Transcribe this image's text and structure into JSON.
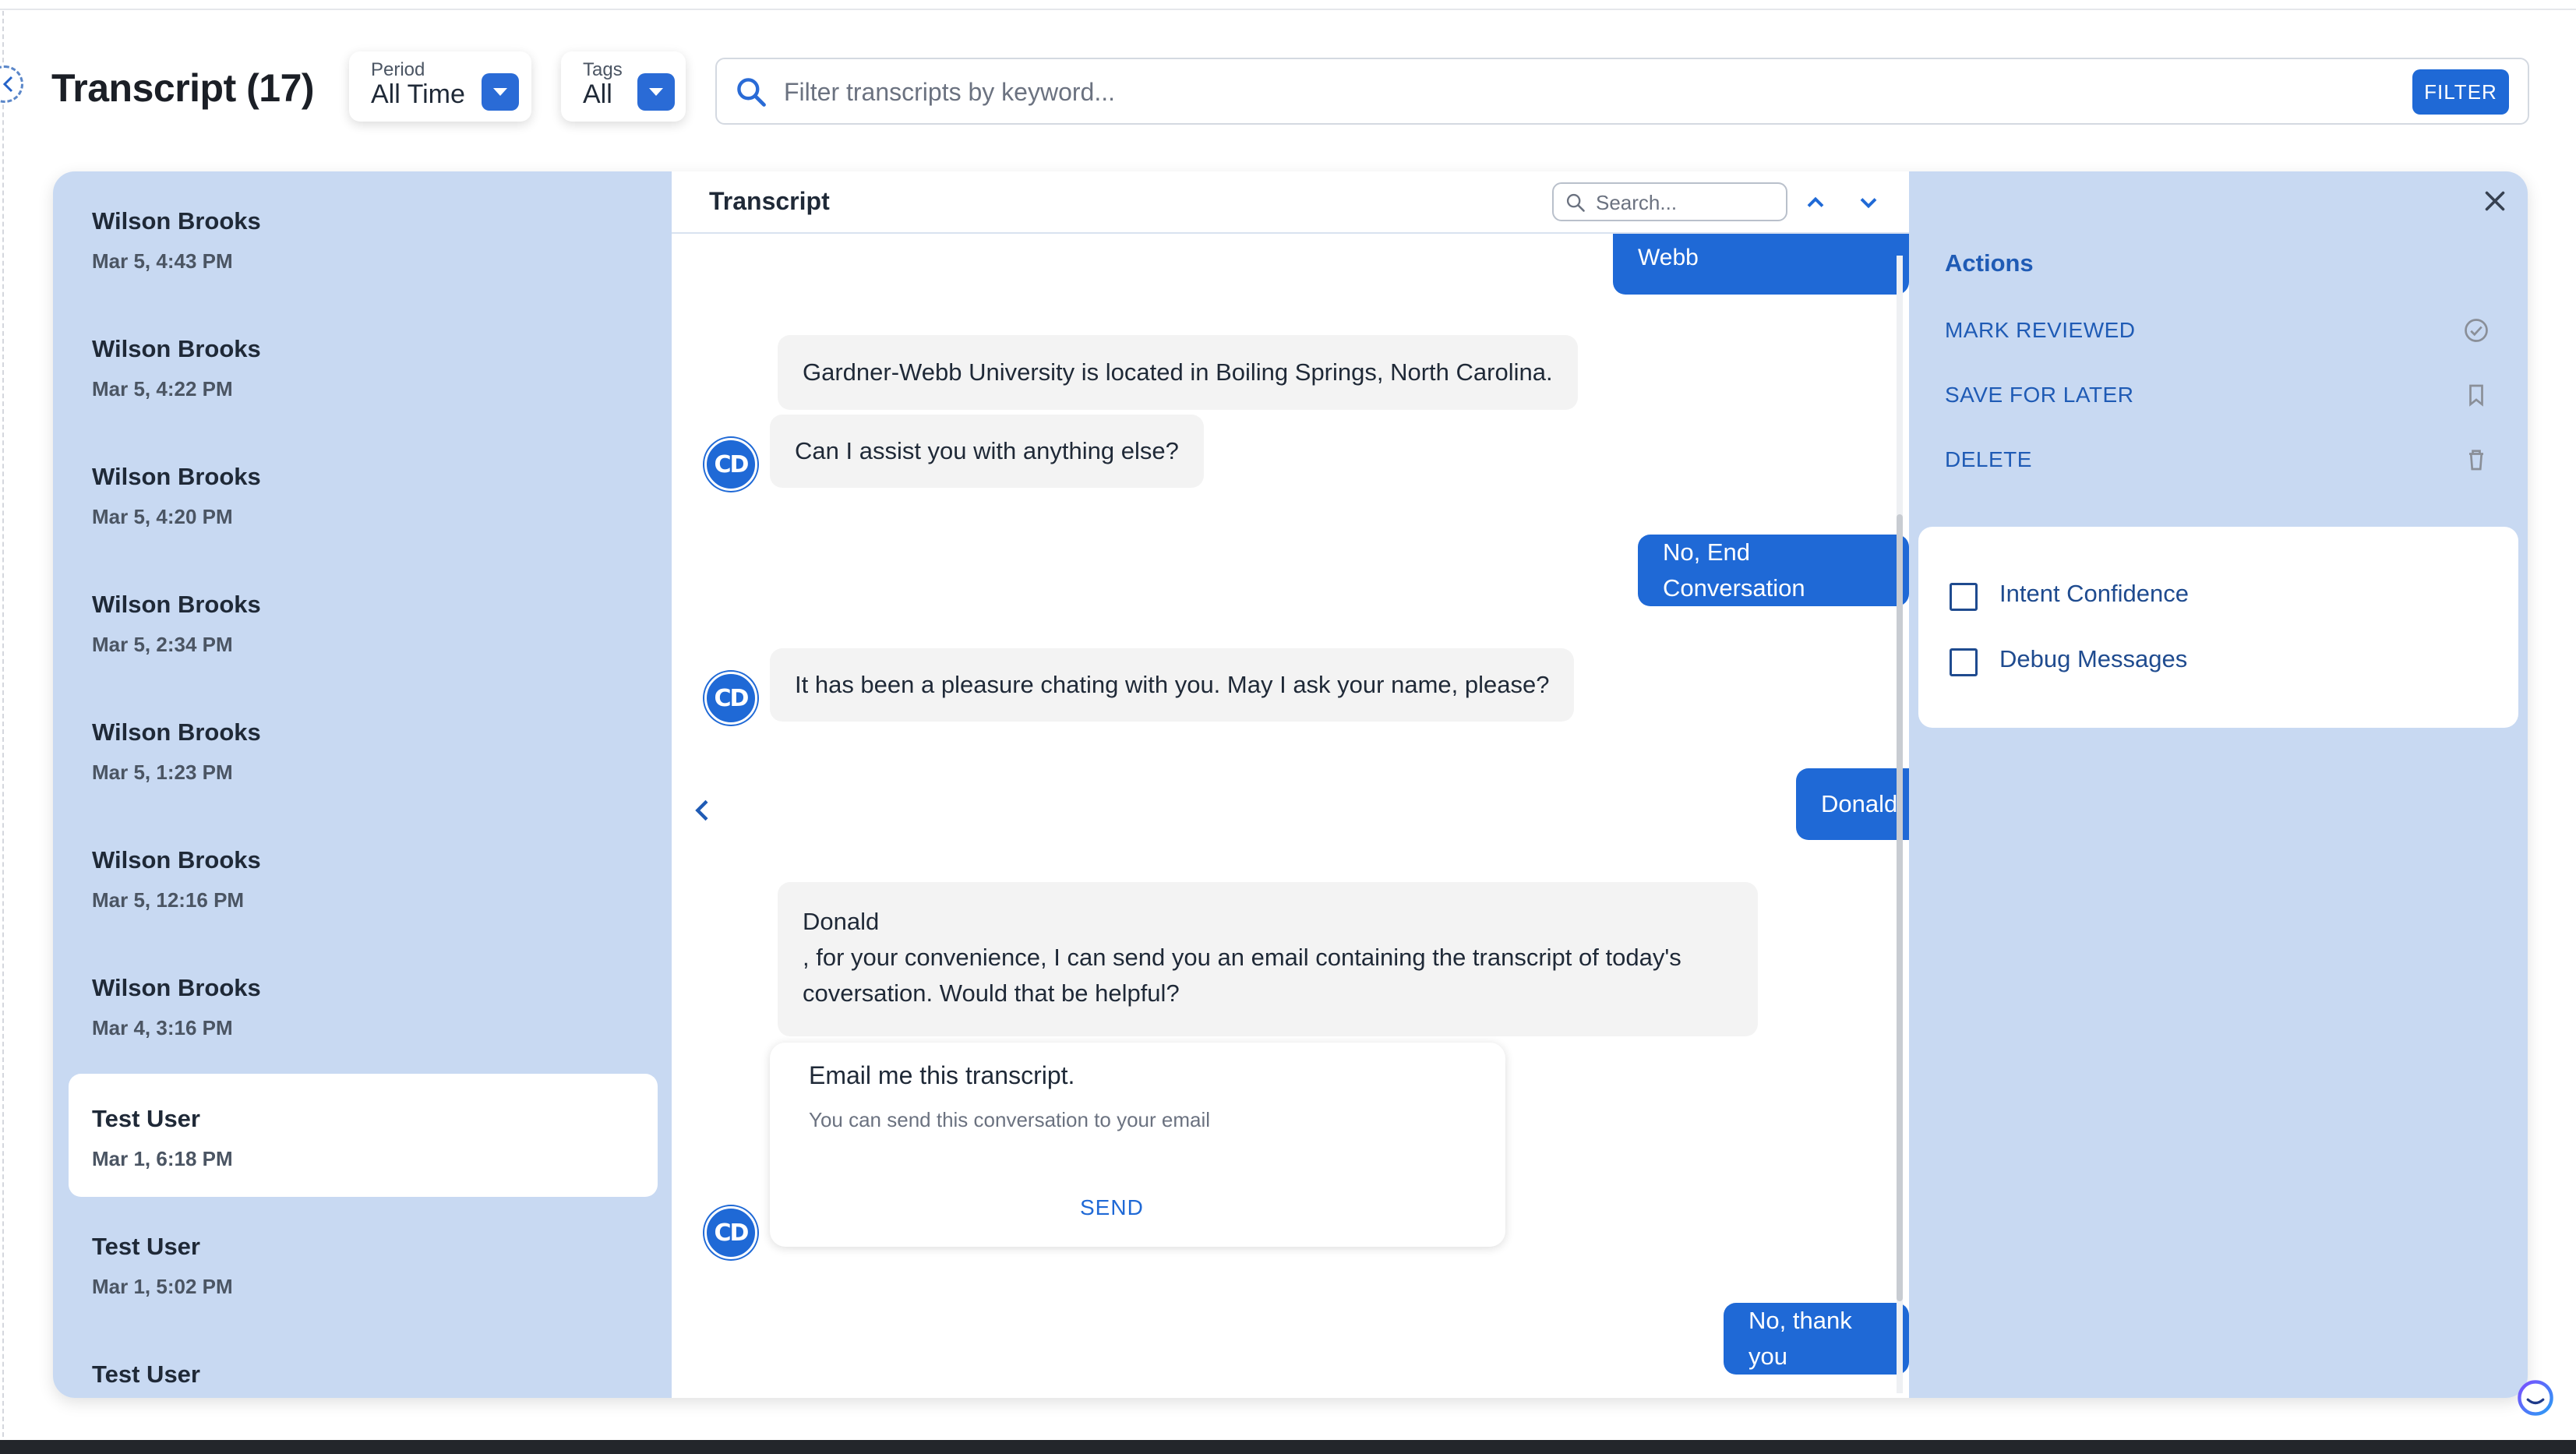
{
  "header": {
    "title": "Transcript (17)",
    "period_label": "Period",
    "period_value": "All Time",
    "tags_label": "Tags",
    "tags_value": "All",
    "search_placeholder": "Filter transcripts by keyword...",
    "filter_button": "FILTER"
  },
  "transcripts": [
    {
      "name": "Wilson Brooks",
      "date": "Mar 5, 4:43 PM"
    },
    {
      "name": "Wilson Brooks",
      "date": "Mar 5, 4:22 PM"
    },
    {
      "name": "Wilson Brooks",
      "date": "Mar 5, 4:20 PM"
    },
    {
      "name": "Wilson Brooks",
      "date": "Mar 5, 2:34 PM"
    },
    {
      "name": "Wilson Brooks",
      "date": "Mar 5, 1:23 PM"
    },
    {
      "name": "Wilson Brooks",
      "date": "Mar 5, 12:16 PM"
    },
    {
      "name": "Wilson Brooks",
      "date": "Mar 4, 3:16 PM"
    },
    {
      "name": "Test User",
      "date": "Mar 1, 6:18 PM",
      "selected": true
    },
    {
      "name": "Test User",
      "date": "Mar 1, 5:02 PM"
    },
    {
      "name": "Test User",
      "date": "",
      "reviewed": true
    }
  ],
  "chat": {
    "title": "Transcript",
    "search_placeholder": "Search...",
    "avatar_text": "CD",
    "messages": [
      {
        "from": "user",
        "text": "Where is Gardner-Webb"
      },
      {
        "from": "bot",
        "text": "Gardner-Webb University is located in Boiling Springs, North Carolina."
      },
      {
        "from": "bot",
        "text": "Can I assist you with anything else?"
      },
      {
        "from": "user",
        "text": "No, End Conversation"
      },
      {
        "from": "bot",
        "text": "It has been a pleasure chating with you. May I ask your name, please?"
      },
      {
        "from": "user",
        "text": "Donald"
      },
      {
        "from": "bot",
        "line1": "Donald",
        "line2": ", for your convenience, I can send you an email containing the transcript of today's",
        "line3": "coversation. Would that be helpful?"
      },
      {
        "from": "user",
        "text": "No, thank you"
      }
    ],
    "email_card": {
      "title": "Email me this transcript.",
      "subtitle": "You can send this conversation to your email",
      "button": "SEND"
    }
  },
  "actions": {
    "title": "Actions",
    "mark_reviewed": "MARK REVIEWED",
    "save_for_later": "SAVE FOR LATER",
    "delete": "DELETE",
    "options": [
      {
        "label": "Intent Confidence",
        "checked": false
      },
      {
        "label": "Debug Messages",
        "checked": false
      }
    ]
  },
  "colors": {
    "accent": "#1f69d6",
    "panel": "#c8d9f2",
    "bot_bubble": "#f3f3f3",
    "action_text": "#1f5bb5"
  }
}
